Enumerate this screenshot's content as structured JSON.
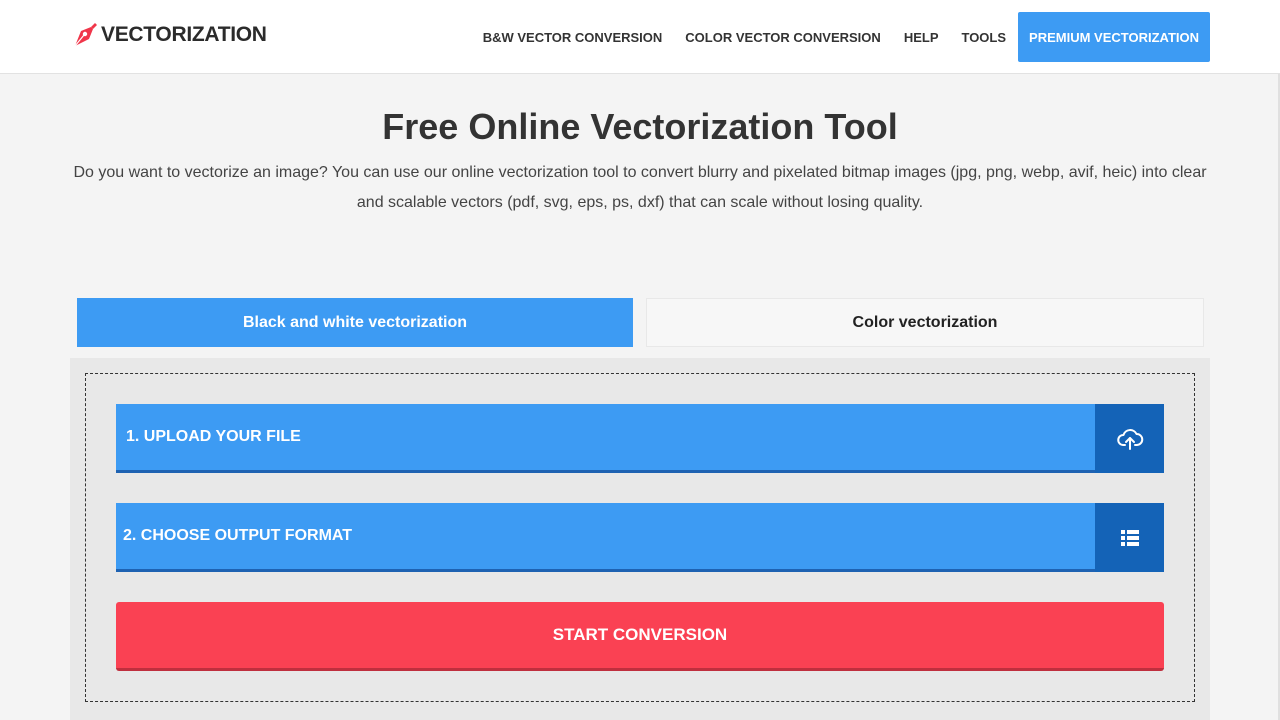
{
  "brand": {
    "name": "VECTORIZATION",
    "accent": "#f0364a"
  },
  "nav": {
    "items": [
      "B&W VECTOR CONVERSION",
      "COLOR VECTOR CONVERSION",
      "HELP",
      "TOOLS"
    ],
    "premium": "PREMIUM VECTORIZATION"
  },
  "hero": {
    "title": "Free Online Vectorization Tool",
    "intro": "Do you want to vectorize an image? You can use our online vectorization tool to convert blurry and pixelated bitmap images (jpg, png, webp, avif, heic) into clear and scalable vectors (pdf, svg, eps, ps, dxf) that can scale without losing quality."
  },
  "tabs": [
    {
      "label": "Black and white vectorization",
      "active": true
    },
    {
      "label": "Color vectorization",
      "active": false
    }
  ],
  "steps": {
    "upload": {
      "label": "1. UPLOAD YOUR FILE",
      "icon": "cloud-upload-icon"
    },
    "format": {
      "label": "2. CHOOSE OUTPUT FORMAT",
      "icon": "list-icon"
    },
    "start": {
      "label": "START CONVERSION"
    }
  },
  "colors": {
    "primary": "#3d9bf3",
    "primary_dark": "#1463b7",
    "danger": "#fa4153"
  }
}
